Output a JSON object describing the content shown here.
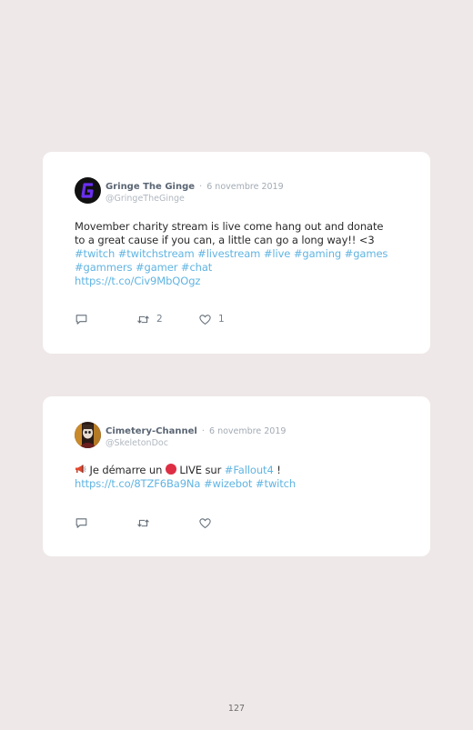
{
  "tweets": [
    {
      "author_name": "Gringe The Ginge",
      "separator": "·",
      "date": "6 novembre 2019",
      "handle": "@GringeTheGinge",
      "text": {
        "line1": "Movember charity stream is live come hang out and donate",
        "line2": "to a great cause if you can, a little can go a long way!! <3",
        "hashtags_line1": [
          "#twitch",
          "#twitchstream",
          "#livestream",
          "#live",
          "#gaming",
          "#games"
        ],
        "hashtags_line2": [
          "#gammers",
          "#gamer",
          "#chat"
        ],
        "url": "https://t.co/Civ9MbQOgz"
      },
      "actions": {
        "reply_icon": "reply-icon",
        "retweet_icon": "retweet-icon",
        "like_icon": "heart-icon",
        "retweet_count": "2",
        "like_count": "1"
      }
    },
    {
      "author_name": "Cimetery-Channel",
      "separator": "·",
      "date": "6 novembre 2019",
      "handle": "@SkeletonDoc",
      "text": {
        "emoji_megaphone": "megaphone-emoji",
        "part1": " Je démarre un ",
        "emoji_red_circle": "red-circle-emoji",
        "part2": " LIVE sur ",
        "hashtag1": "#Fallout4",
        "part3": " !",
        "url": "https://t.co/8TZF6Ba9Na",
        "hashtags_line2": [
          "#wizebot",
          "#twitch"
        ]
      },
      "actions": {
        "reply_icon": "reply-icon",
        "retweet_icon": "retweet-icon",
        "like_icon": "heart-icon",
        "retweet_count": "",
        "like_count": ""
      }
    }
  ],
  "footer": {
    "page_number": "127"
  },
  "colors": {
    "page_background": "#efe8e8",
    "card_background": "#ffffff",
    "link": "#60b4e2",
    "author_name": "#5a6573",
    "muted": "#a2abb4"
  }
}
